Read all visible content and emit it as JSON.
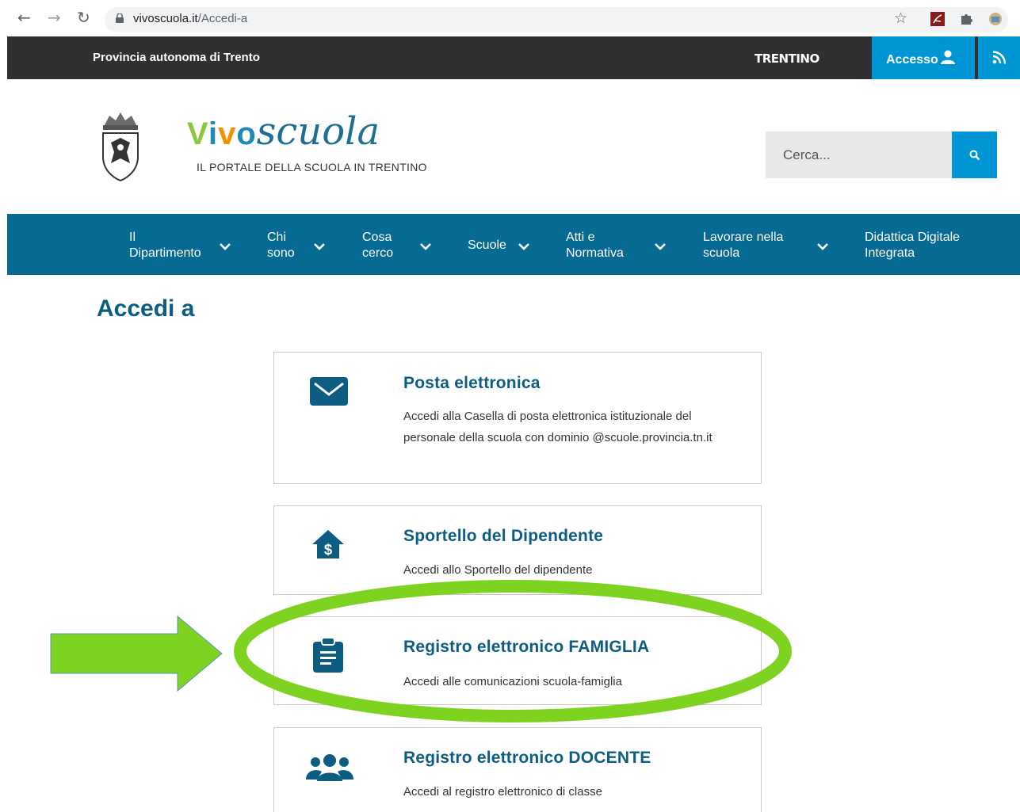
{
  "browser": {
    "url_host": "vivoscuola.it",
    "url_path": "/Accedi-a",
    "icons": [
      "back-arrow-icon",
      "forward-arrow-icon",
      "reload-icon",
      "lock-icon",
      "star-icon",
      "pdf-icon",
      "puzzle-icon",
      "extension-icon"
    ]
  },
  "topbar": {
    "title": "Provincia autonoma di Trento",
    "logo_text": "TRENTINO",
    "access_label": "Accesso",
    "colors": {
      "bar": "#2e3032",
      "accent": "#0096d6"
    }
  },
  "header": {
    "brand_vivo": "Vivo",
    "brand_scuola": "scuola",
    "tagline": "IL PORTALE DELLA SCUOLA IN TRENTINO",
    "search_placeholder": "Cerca..."
  },
  "nav": {
    "items": [
      {
        "label": "Il\nDipartimento"
      },
      {
        "label": "Chi\nsono"
      },
      {
        "label": "Cosa\ncerco"
      },
      {
        "label": "Scuole"
      },
      {
        "label": "Atti e\nNormativa"
      },
      {
        "label": "Lavorare nella\nscuola"
      },
      {
        "label": "Didattica Digitale\nIntegrata"
      }
    ],
    "color": "#066a93"
  },
  "main": {
    "title": "Accedi a",
    "cards": [
      {
        "title": "Posta elettronica",
        "desc": "Accedi alla Casella di posta elettronica istituzionale del personale della scuola con dominio @scuole.provincia.tn.it",
        "icon": "envelope-icon"
      },
      {
        "title": "Sportello del Dipendente",
        "desc": "Accedi allo Sportello del dipendente",
        "icon": "house-dollar-icon"
      },
      {
        "title": "Registro elettronico FAMIGLIA",
        "desc": "Accedi alle comunicazioni scuola-famiglia",
        "icon": "clipboard-icon"
      },
      {
        "title": "Registro elettronico DOCENTE",
        "desc": "Accedi al registro elettronico di classe",
        "icon": "users-icon"
      }
    ]
  },
  "annotation": {
    "color": "#7ed321"
  }
}
